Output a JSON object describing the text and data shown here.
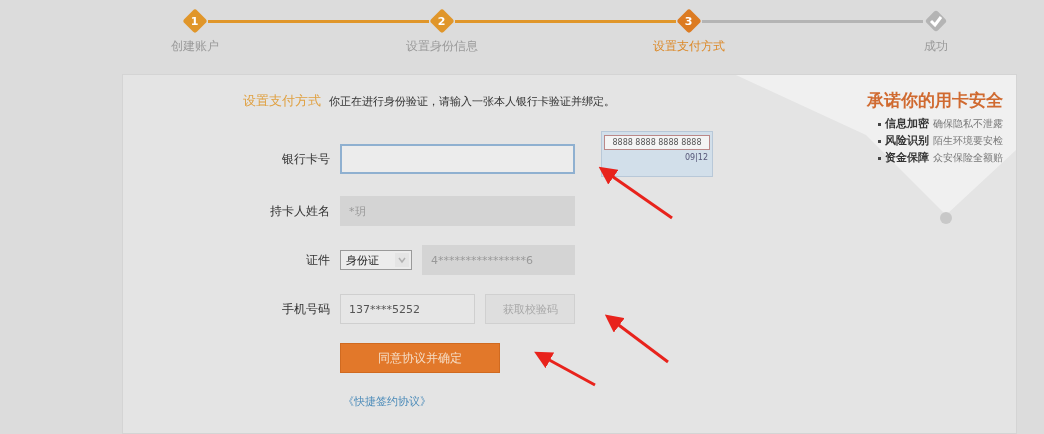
{
  "steps": [
    {
      "number": "1",
      "label": "创建账户",
      "completed": true,
      "selected": false
    },
    {
      "number": "2",
      "label": "设置身份信息",
      "completed": true,
      "selected": false
    },
    {
      "number": "3",
      "label": "设置支付方式",
      "completed": false,
      "selected": true
    },
    {
      "label": "成功",
      "completed": false,
      "selected": false
    }
  ],
  "section": {
    "title": "设置支付方式",
    "description": "你正在进行身份验证，请输入一张本人银行卡验证并绑定。"
  },
  "form": {
    "rows": [
      {
        "kind": "card",
        "label": "银行卡号",
        "field": {
          "focused": true,
          "disabled": false
        },
        "card_sample": {
          "number": "8888 8888 8888 8888",
          "expiry": "09|12"
        }
      },
      {
        "kind": "text",
        "label": "持卡人姓名",
        "field": {
          "value": "*玥",
          "focused": false,
          "disabled": true
        }
      },
      {
        "kind": "id",
        "label": "证件",
        "select": {
          "value": "身份证"
        },
        "field": {
          "value": "4****************6",
          "focused": false,
          "disabled": true
        }
      },
      {
        "kind": "phone",
        "label": "手机号码",
        "field": {
          "value": "137****5252",
          "focused": false,
          "disabled": false
        },
        "button": {
          "label": "获取校验码",
          "disabled": true
        }
      }
    ],
    "submit": {
      "label": "同意协议并确定"
    },
    "agreement_link": "《快捷签约协议》"
  },
  "promise": {
    "title": "承诺你的用卡安全",
    "items": [
      {
        "term": "信息加密",
        "text": "确保隐私不泄露"
      },
      {
        "term": "风险识别",
        "text": "陌生环境要安检"
      },
      {
        "term": "资金保障",
        "text": "众安保险全额赔"
      }
    ]
  }
}
